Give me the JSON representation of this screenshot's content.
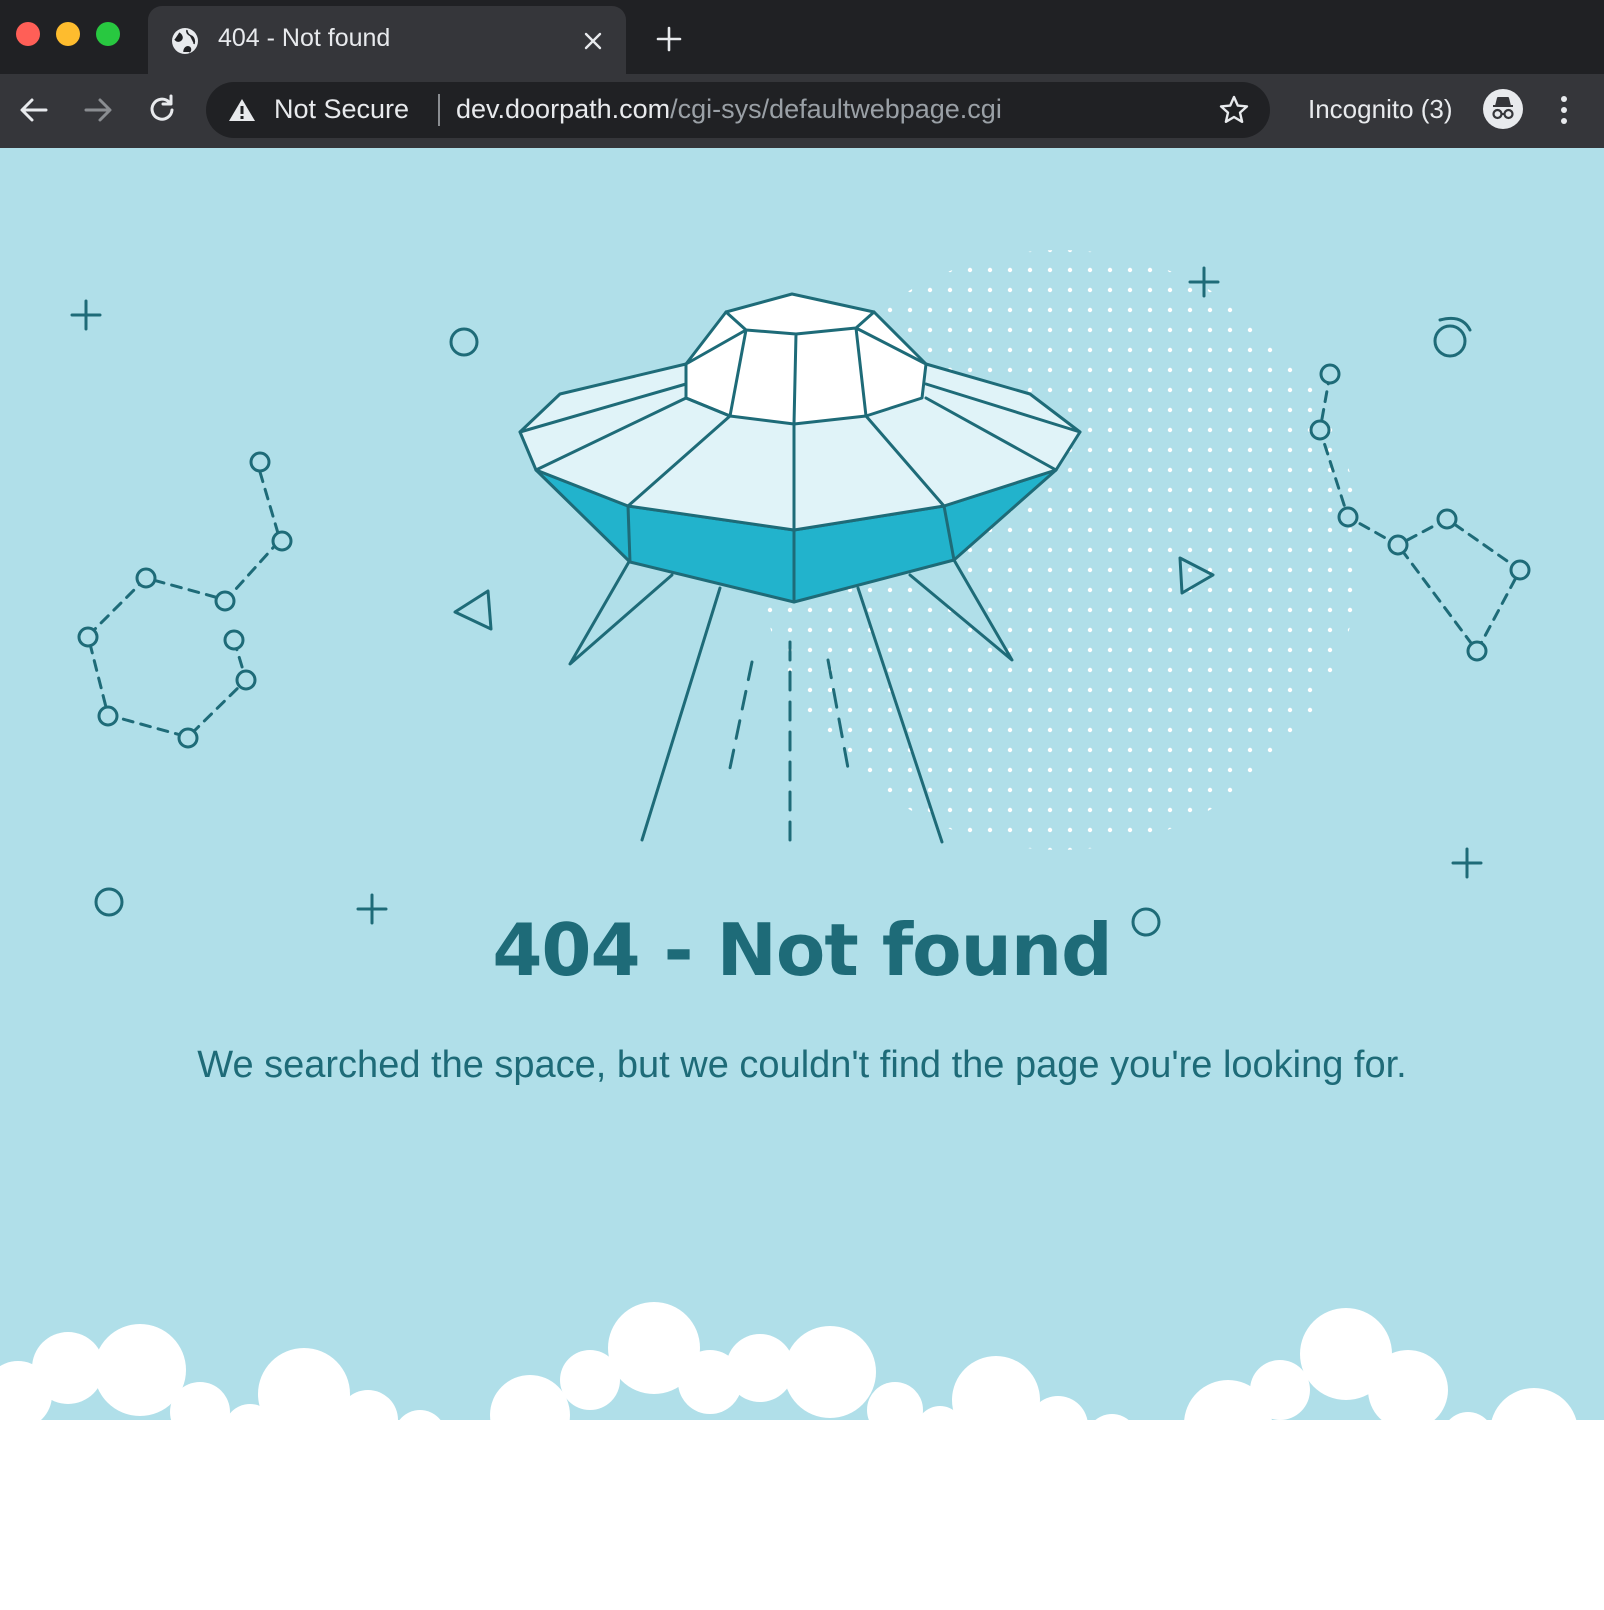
{
  "window": {
    "tab": {
      "title": "404 - Not found",
      "favicon": "globe-icon"
    },
    "toolbar": {
      "back_icon": "arrow-left-icon",
      "forward_icon": "arrow-right-icon",
      "reload_icon": "reload-icon"
    },
    "omnibox": {
      "security_label": "Not Secure",
      "url_host": "dev.doorpath.com",
      "url_path": "/cgi-sys/defaultwebpage.cgi",
      "bookmark_icon": "star-icon"
    },
    "incognito": {
      "label": "Incognito (3)",
      "icon": "incognito-icon"
    },
    "menu_icon": "kebab-menu-icon"
  },
  "page": {
    "headline": "404 - Not found",
    "message": "We searched the space, but we couldn't find the page you're looking for.",
    "illustration": "ufo-illustration"
  },
  "colors": {
    "page_background": "#b0dfe9",
    "text": "#1e6b78",
    "ufo_band": "#22b3cc",
    "ufo_dome": "#ffffff",
    "ufo_body": "#e0f3f8",
    "chrome_dark": "#202124",
    "chrome_toolbar": "#35363a"
  }
}
